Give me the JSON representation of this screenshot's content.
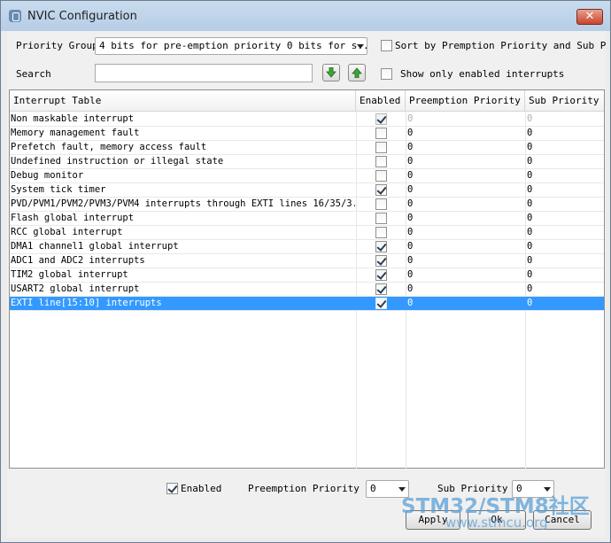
{
  "window": {
    "title": "NVIC Configuration",
    "close_glyph": "✕"
  },
  "controls": {
    "priority_group_label": "Priority Group",
    "priority_group_value": "4 bits for pre-emption priority 0 bits for s...",
    "sort_label": "Sort by Premption Priority and Sub Prior",
    "sort_checked": false,
    "search_label": "Search",
    "search_value": "",
    "search_down_icon": "green-arrow-down-icon",
    "search_up_icon": "green-arrow-up-icon",
    "show_enabled_label": "Show only enabled interrupts",
    "show_enabled_checked": false
  },
  "table": {
    "columns": [
      "Interrupt Table",
      "Enabled",
      "Preemption Priority",
      "Sub Priority"
    ],
    "rows": [
      {
        "name": "Non maskable interrupt",
        "enabled": true,
        "locked": true,
        "preemption": "0",
        "sub": "0"
      },
      {
        "name": "Memory management fault",
        "enabled": false,
        "locked": false,
        "preemption": "0",
        "sub": "0"
      },
      {
        "name": "Prefetch fault, memory access fault",
        "enabled": false,
        "locked": false,
        "preemption": "0",
        "sub": "0"
      },
      {
        "name": "Undefined instruction or illegal state",
        "enabled": false,
        "locked": false,
        "preemption": "0",
        "sub": "0"
      },
      {
        "name": "Debug monitor",
        "enabled": false,
        "locked": false,
        "preemption": "0",
        "sub": "0"
      },
      {
        "name": "System tick timer",
        "enabled": true,
        "locked": false,
        "preemption": "0",
        "sub": "0"
      },
      {
        "name": "PVD/PVM1/PVM2/PVM3/PVM4 interrupts through EXTI lines 16/35/3...",
        "enabled": false,
        "locked": false,
        "preemption": "0",
        "sub": "0"
      },
      {
        "name": "Flash global interrupt",
        "enabled": false,
        "locked": false,
        "preemption": "0",
        "sub": "0"
      },
      {
        "name": "RCC global interrupt",
        "enabled": false,
        "locked": false,
        "preemption": "0",
        "sub": "0"
      },
      {
        "name": "DMA1 channel1 global interrupt",
        "enabled": true,
        "locked": false,
        "preemption": "0",
        "sub": "0"
      },
      {
        "name": "ADC1 and ADC2 interrupts",
        "enabled": true,
        "locked": false,
        "preemption": "0",
        "sub": "0"
      },
      {
        "name": "TIM2 global interrupt",
        "enabled": true,
        "locked": false,
        "preemption": "0",
        "sub": "0"
      },
      {
        "name": "USART2 global interrupt",
        "enabled": true,
        "locked": false,
        "preemption": "0",
        "sub": "0"
      },
      {
        "name": "EXTI line[15:10] interrupts",
        "enabled": true,
        "locked": false,
        "preemption": "0",
        "sub": "0",
        "selected": true
      }
    ]
  },
  "footer": {
    "enabled_label": "Enabled",
    "enabled_checked": true,
    "preemption_label": "Preemption Priority",
    "preemption_value": "0",
    "sub_label": "Sub Priority",
    "sub_value": "0",
    "apply_label": "Apply",
    "ok_label": "Ok",
    "cancel_label": "Cancel"
  },
  "watermark": {
    "text": "STM32/STM8社区",
    "url": "www.stmcu.org"
  },
  "colors": {
    "selection": "#3399ff",
    "titlebar": "#c9dcef",
    "arrow_green": "#3fa535"
  }
}
